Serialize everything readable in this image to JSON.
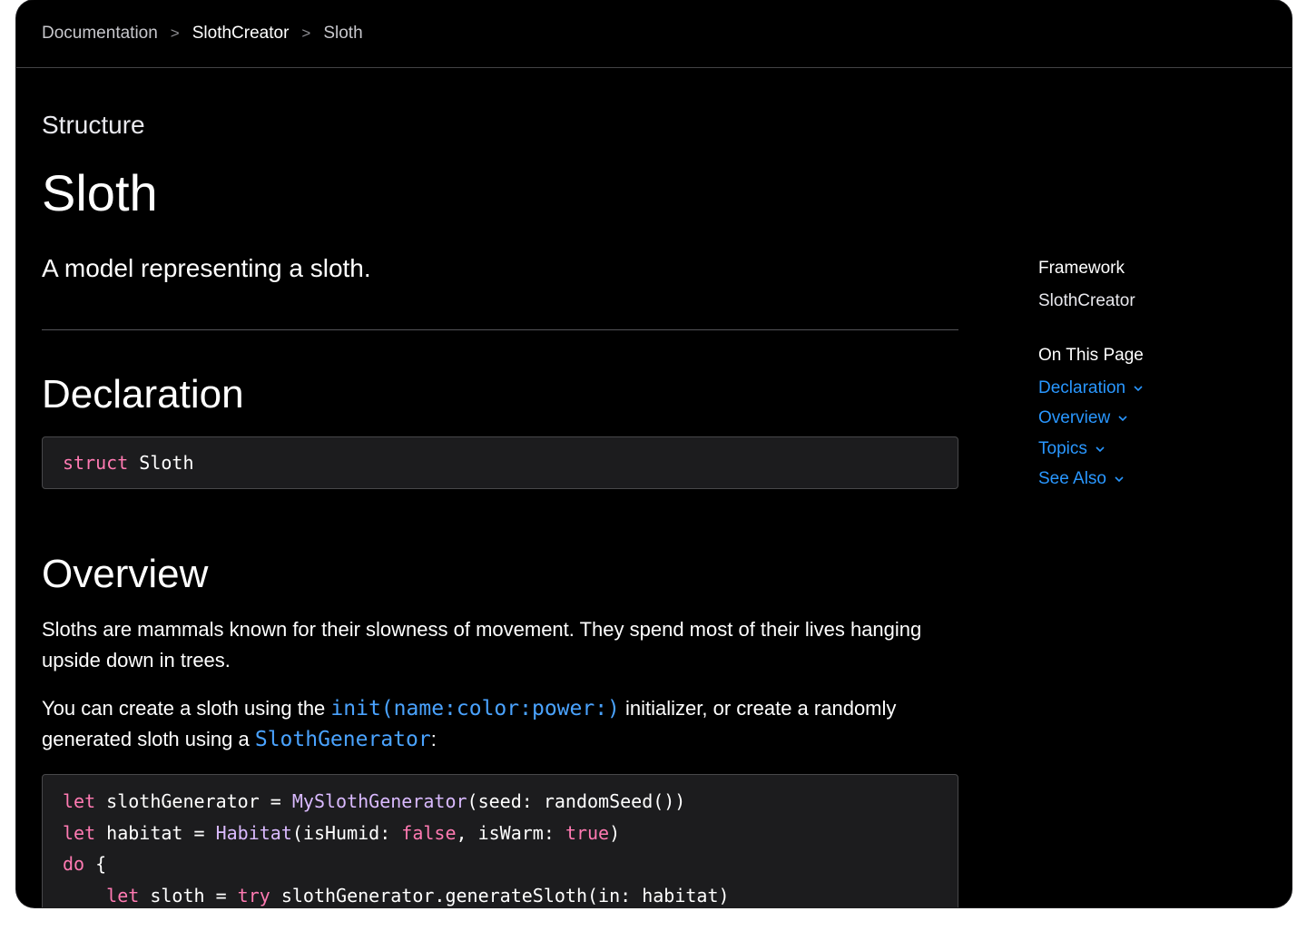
{
  "breadcrumb": {
    "items": [
      "Documentation",
      "SlothCreator",
      "Sloth"
    ],
    "separator": ">"
  },
  "header": {
    "eyebrow": "Structure",
    "title": "Sloth",
    "abstract": "A model representing a sloth."
  },
  "declaration": {
    "heading": "Declaration",
    "keyword": "struct",
    "name": "Sloth"
  },
  "overview": {
    "heading": "Overview",
    "paragraph1": "Sloths are mammals known for their slowness of movement. They spend most of their lives hanging upside down in trees.",
    "paragraph2": {
      "text1": "You can create a sloth using the ",
      "link1": "init(name:color:power:)",
      "text2": " initializer, or create a randomly generated sloth using a ",
      "link2": "SlothGenerator",
      "text3": ":"
    },
    "code": {
      "line1": {
        "kw": "let",
        "a": " slothGenerator = ",
        "type": "MySlothGenerator",
        "b": "(seed: randomSeed())"
      },
      "line2": {
        "kw": "let",
        "a": " habitat = ",
        "type": "Habitat",
        "b": "(isHumid: ",
        "kw2": "false",
        "c": ", isWarm: ",
        "kw3": "true",
        "d": ")"
      },
      "line3": {
        "kw": "do",
        "a": " {"
      },
      "line4": {
        "indent": "    ",
        "kw": "let",
        "a": " sloth = ",
        "kw2": "try",
        "b": " slothGenerator.generateSloth(in: habitat)"
      }
    }
  },
  "sidebar": {
    "framework_label": "Framework",
    "framework_value": "SlothCreator",
    "on_this_page_label": "On This Page",
    "links": [
      "Declaration",
      "Overview",
      "Topics",
      "See Also"
    ]
  },
  "colors": {
    "background": "#000000",
    "link": "#2997ff",
    "keyword": "#ff7ab2",
    "type": "#dabaff"
  }
}
